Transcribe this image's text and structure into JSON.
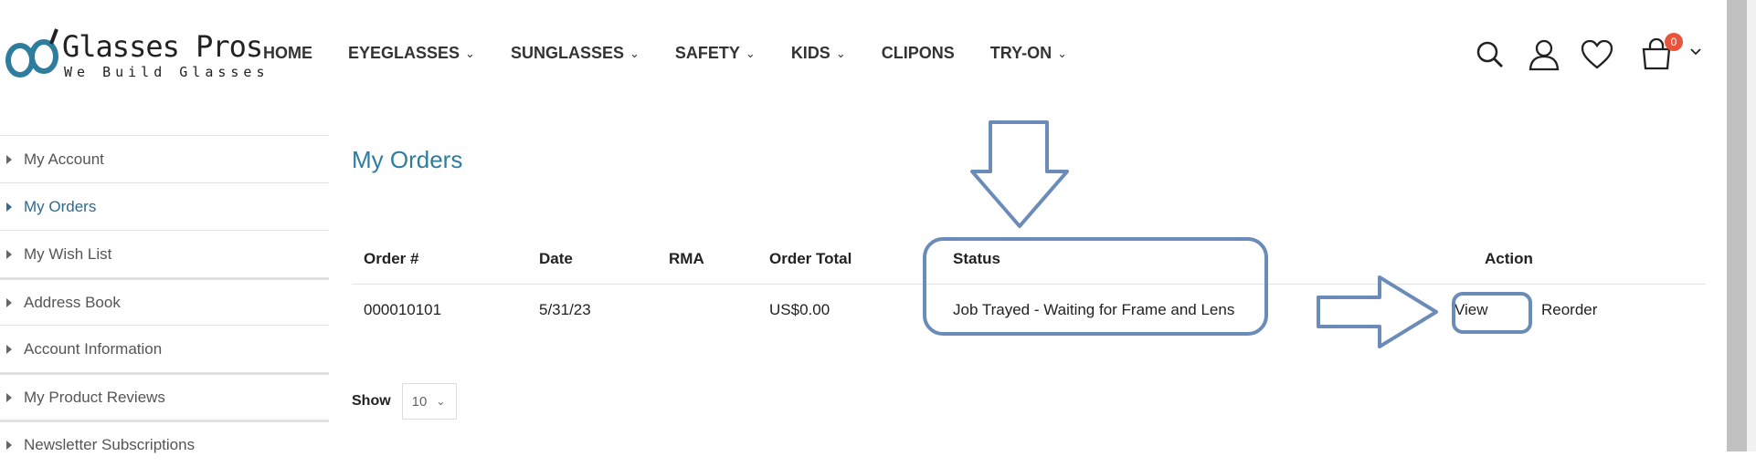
{
  "brand": {
    "name": "Glasses Pros",
    "tagline": "We Build Glasses"
  },
  "nav": {
    "items": [
      {
        "label": "HOME",
        "dropdown": false
      },
      {
        "label": "EYEGLASSES",
        "dropdown": true
      },
      {
        "label": "SUNGLASSES",
        "dropdown": true
      },
      {
        "label": "SAFETY",
        "dropdown": true
      },
      {
        "label": "KIDS",
        "dropdown": true
      },
      {
        "label": "CLIPONS",
        "dropdown": false
      },
      {
        "label": "TRY-ON",
        "dropdown": true
      }
    ]
  },
  "header": {
    "cart_count": "0"
  },
  "sidebar": {
    "items": [
      {
        "label": "My Account",
        "active": false
      },
      {
        "label": "My Orders",
        "active": true
      },
      {
        "label": "My Wish List",
        "active": false
      },
      {
        "label": "Address Book",
        "active": false
      },
      {
        "label": "Account Information",
        "active": false
      },
      {
        "label": "My Product Reviews",
        "active": false
      },
      {
        "label": "Newsletter Subscriptions",
        "active": false
      }
    ]
  },
  "main": {
    "title": "My Orders",
    "table": {
      "headers": {
        "order": "Order #",
        "date": "Date",
        "rma": "RMA",
        "total": "Order Total",
        "status": "Status",
        "action": "Action"
      },
      "rows": [
        {
          "order": "000010101",
          "date": "5/31/23",
          "rma": "",
          "total": "US$0.00",
          "status": "Job Trayed - Waiting for Frame and Lens",
          "view": "View",
          "reorder": "Reorder"
        }
      ]
    },
    "pager": {
      "show_label": "Show",
      "per_page": "10"
    }
  },
  "colors": {
    "accent": "#2e6a8e",
    "title": "#2e7d9e",
    "annotation": "#6b8bb8",
    "badge": "#e8543b"
  }
}
